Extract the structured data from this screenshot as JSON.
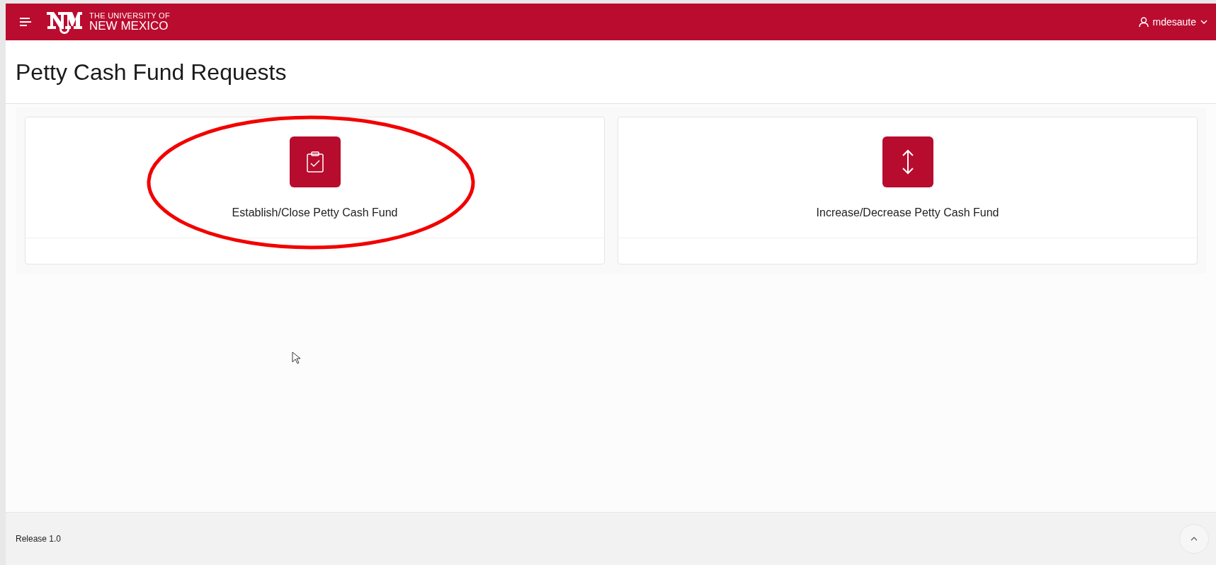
{
  "header": {
    "logo_line_1": "THE UNIVERSITY OF",
    "logo_line_2": "NEW MEXICO",
    "user": "mdesaute"
  },
  "page": {
    "title": "Petty Cash Fund Requests"
  },
  "cards": [
    {
      "kind": "clipboard",
      "label": "Establish/Close Petty Cash Fund",
      "circled": true
    },
    {
      "kind": "updown",
      "label": "Increase/Decrease Petty Cash Fund",
      "circled": false
    }
  ],
  "footer": {
    "release": "Release 1.0"
  }
}
